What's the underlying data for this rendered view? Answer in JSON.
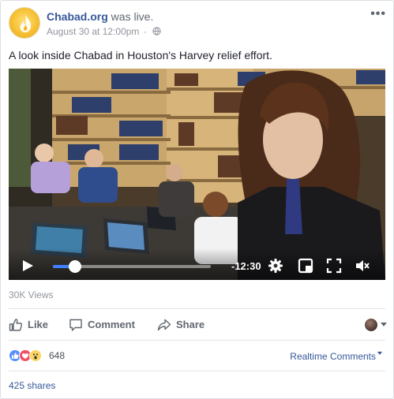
{
  "post": {
    "page_name": "Chabad.org",
    "status_text": "was live.",
    "timestamp": "August 30 at 12:00pm",
    "separator": "·",
    "privacy_icon": "globe-icon",
    "more_icon": "ellipsis-icon",
    "caption": "A look inside Chabad in Houston's Harvey relief effort."
  },
  "video": {
    "time_remaining": "-12:30",
    "progress_fraction": 0.14,
    "icons": [
      "play-icon",
      "settings-gear-icon",
      "pop-out-icon",
      "fullscreen-icon",
      "mute-icon"
    ]
  },
  "stats": {
    "views": "30K Views",
    "reactions_count": "648",
    "reaction_icons": [
      "like-reaction-icon",
      "love-reaction-icon",
      "wow-reaction-icon"
    ],
    "realtime_label": "Realtime Comments",
    "shares": "425 shares"
  },
  "actions": {
    "like": "Like",
    "comment": "Comment",
    "share": "Share"
  },
  "colors": {
    "link": "#365899",
    "muted": "#90949c",
    "action_text": "#616770",
    "progress": "#4080ff"
  }
}
